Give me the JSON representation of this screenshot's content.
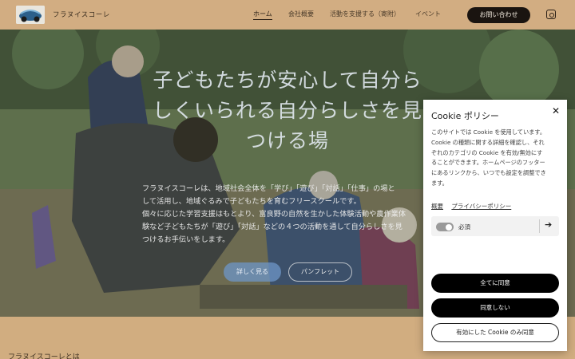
{
  "header": {
    "site_name": "フラヌイスコーレ",
    "nav": [
      "ホーム",
      "会社概要",
      "活動を支援する（寄附）",
      "イベント"
    ],
    "active_nav": "ホーム",
    "contact_button": "お問い合わせ",
    "social_icon": "instagram-icon"
  },
  "hero": {
    "title_lines": [
      "子どもたちが安心して自分ら",
      "しくいられる自分らしさを見",
      "つける場"
    ],
    "body_lines": [
      "フラヌイスコーレは、地域社会全体を「学び」「遊び」「対話」「仕事」の場と",
      "して活用し、地域ぐるみで子どもたちを育むフリースクールです。",
      " 個々に応じた学習支援はもとより、富良野の自然を生かした体験活動や農作業体",
      "験など子どもたちが「遊び」「対話」などの４つの活動を通して自分らしさを見",
      "つけるお手伝いをします。"
    ],
    "primary_button": "詳しく見る",
    "secondary_button": "パンフレット"
  },
  "about_heading": "フラヌイスコーレとは",
  "cookie": {
    "title": "Cookie ポリシー",
    "close_icon": "close-icon",
    "description_lines": [
      "このサイトでは Cookie を使用しています。",
      "Cookie の種類に関する詳細を確認し、それ",
      "ぞれのカテゴリの Cookie を有効/無効にす",
      "ることができます。ホームページのフッター",
      "にあるリンクから、いつでも設定を調整でき",
      "ます。"
    ],
    "links": [
      "概要",
      "プライバシーポリシー"
    ],
    "category_label": "必須",
    "buttons": {
      "accept_all": "全てに同意",
      "reject": "同意しない",
      "accept_selected": "有効にした Cookie のみ同意"
    }
  },
  "colors": {
    "header_bg": "#d2ad82",
    "button_dark": "#1a1410",
    "hero_button": "#6e96c8"
  }
}
